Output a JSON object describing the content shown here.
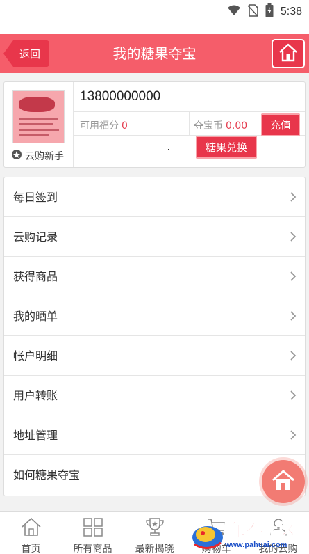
{
  "status_bar": {
    "time": "5:38"
  },
  "header": {
    "back_label": "返回",
    "title": "我的糖果夺宝",
    "home_icon": "home-icon"
  },
  "profile": {
    "phone": "13800000000",
    "level": "云购新手",
    "points_label": "可用福分",
    "points_value": "0",
    "coins_label": "夺宝币",
    "coins_value": "0.00",
    "recharge_label": "充值",
    "exchange_label": "糖果兑换"
  },
  "menu": {
    "items": [
      {
        "label": "每日签到"
      },
      {
        "label": "云购记录"
      },
      {
        "label": "获得商品"
      },
      {
        "label": "我的晒单"
      },
      {
        "label": "帐户明细"
      },
      {
        "label": "用户转账"
      },
      {
        "label": "地址管理"
      },
      {
        "label": "如何糖果夺宝"
      }
    ]
  },
  "bottom_nav": {
    "items": [
      {
        "label": "首页",
        "icon": "home-icon"
      },
      {
        "label": "所有商品",
        "icon": "grid-icon"
      },
      {
        "label": "最新揭晓",
        "icon": "trophy-icon"
      },
      {
        "label": "购物车",
        "icon": "cart-icon"
      },
      {
        "label": "我的云购",
        "icon": "user-icon"
      }
    ]
  },
  "watermark": {
    "text": "怕坏社区",
    "url": "www.pahuai.com"
  },
  "colors": {
    "accent": "#e8364b",
    "header": "#f55d6a",
    "value_red": "#e53d4f"
  }
}
